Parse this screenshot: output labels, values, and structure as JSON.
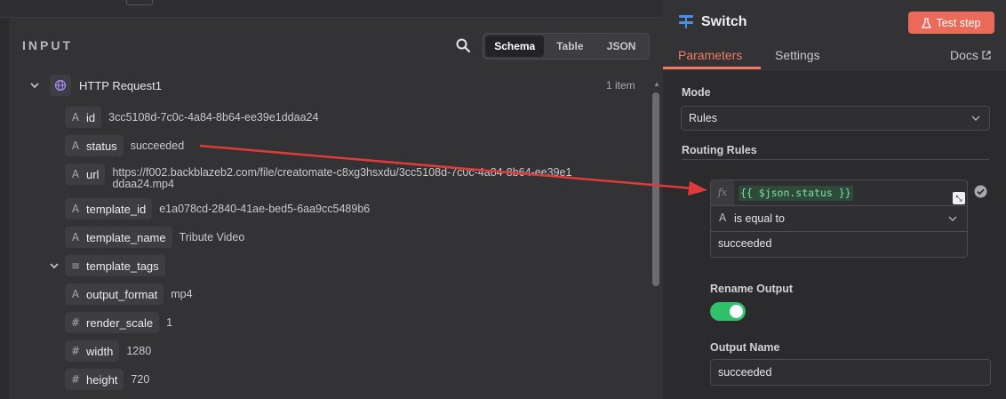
{
  "input_panel": {
    "title": "INPUT",
    "view_tabs": [
      "Schema",
      "Table",
      "JSON"
    ],
    "active_view": "Schema",
    "root": {
      "label": "HTTP Request1",
      "count": "1 item"
    },
    "fields": [
      {
        "type": "A",
        "key": "id",
        "value": "3cc5108d-7c0c-4a84-8b64-ee39e1ddaa24"
      },
      {
        "type": "A",
        "key": "status",
        "value": "succeeded"
      },
      {
        "type": "A",
        "key": "url",
        "value": "https://f002.backblazeb2.com/file/creatomate-c8xg3hsxdu/3cc5108d-7c0c-4a84-8b64-ee39e1ddaa24.mp4"
      },
      {
        "type": "A",
        "key": "template_id",
        "value": "e1a078cd-2840-41ae-bed5-6aa9cc5489b6"
      },
      {
        "type": "A",
        "key": "template_name",
        "value": "Tribute Video"
      },
      {
        "type": "≡",
        "key": "template_tags",
        "value": ""
      },
      {
        "type": "A",
        "key": "output_format",
        "value": "mp4"
      },
      {
        "type": "#",
        "key": "render_scale",
        "value": "1"
      },
      {
        "type": "#",
        "key": "width",
        "value": "1280"
      },
      {
        "type": "#",
        "key": "height",
        "value": "720"
      }
    ]
  },
  "node_panel": {
    "title": "Switch",
    "test_button": "Test step",
    "tabs": [
      "Parameters",
      "Settings"
    ],
    "active_tab": "Parameters",
    "docs_link": "Docs",
    "mode_label": "Mode",
    "mode_value": "Rules",
    "routing_rules_label": "Routing Rules",
    "rule": {
      "expression": "{{ $json.status }}",
      "operator_type": "A",
      "operator": "is equal to",
      "value": "succeeded"
    },
    "rename_output_label": "Rename Output",
    "rename_output_enabled": true,
    "output_name_label": "Output Name",
    "output_name_value": "succeeded"
  },
  "colors": {
    "accent": "#ea6b59",
    "tab_active": "#f07a64",
    "toggle_on": "#2fc26b",
    "arrow": "#e03a3a",
    "expression_text": "#7fe0a8"
  }
}
